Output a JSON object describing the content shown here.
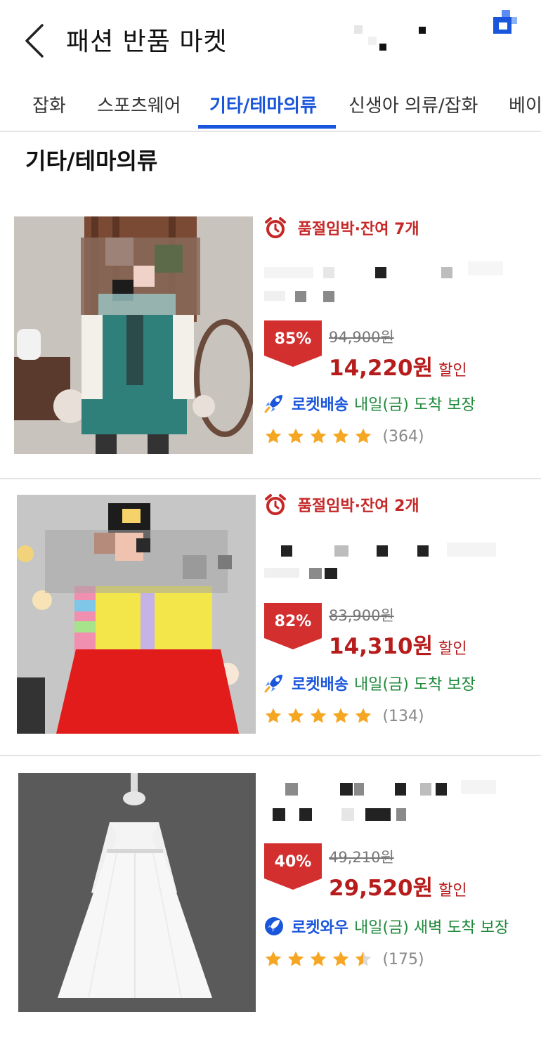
{
  "header": {
    "title": "패션 반품 마켓"
  },
  "tabs": [
    {
      "label": "잡화",
      "active": false
    },
    {
      "label": "스포츠웨어",
      "active": false
    },
    {
      "label": "기타/테마의류",
      "active": true
    },
    {
      "label": "신생아 의류/잡화",
      "active": false
    },
    {
      "label": "베이",
      "active": false
    }
  ],
  "section": {
    "title": "기타/테마의류"
  },
  "products": [
    {
      "urgency": "품절임박·잔여 7개",
      "discount": "85%",
      "original_price": "94,900원",
      "sale_price": "14,220원",
      "sale_suffix": "할인",
      "shipping_brand": "로켓배송",
      "shipping_eta": "내일(금) 도착 보장",
      "rating": 5,
      "review_count": "(364)"
    },
    {
      "urgency": "품절임박·잔여 2개",
      "discount": "82%",
      "original_price": "83,900원",
      "sale_price": "14,310원",
      "sale_suffix": "할인",
      "shipping_brand": "로켓배송",
      "shipping_eta": "내일(금) 도착 보장",
      "rating": 5,
      "review_count": "(134)"
    },
    {
      "urgency": "",
      "discount": "40%",
      "original_price": "49,210원",
      "sale_price": "29,520원",
      "sale_suffix": "할인",
      "shipping_brand": "로켓와우",
      "shipping_eta": "내일(금) 새벽 도착 보장",
      "rating": 4.5,
      "review_count": "(175)"
    }
  ],
  "colors": {
    "accent_blue": "#1a56db",
    "discount_red": "#d32f2f",
    "price_red": "#b71c1c",
    "eta_green": "#1f8a3b",
    "star_gold": "#f5a623"
  },
  "icons": {
    "back": "chevron-left-icon",
    "alarm": "alarm-clock-icon",
    "rocket": "rocket-icon",
    "star": "star-icon"
  }
}
